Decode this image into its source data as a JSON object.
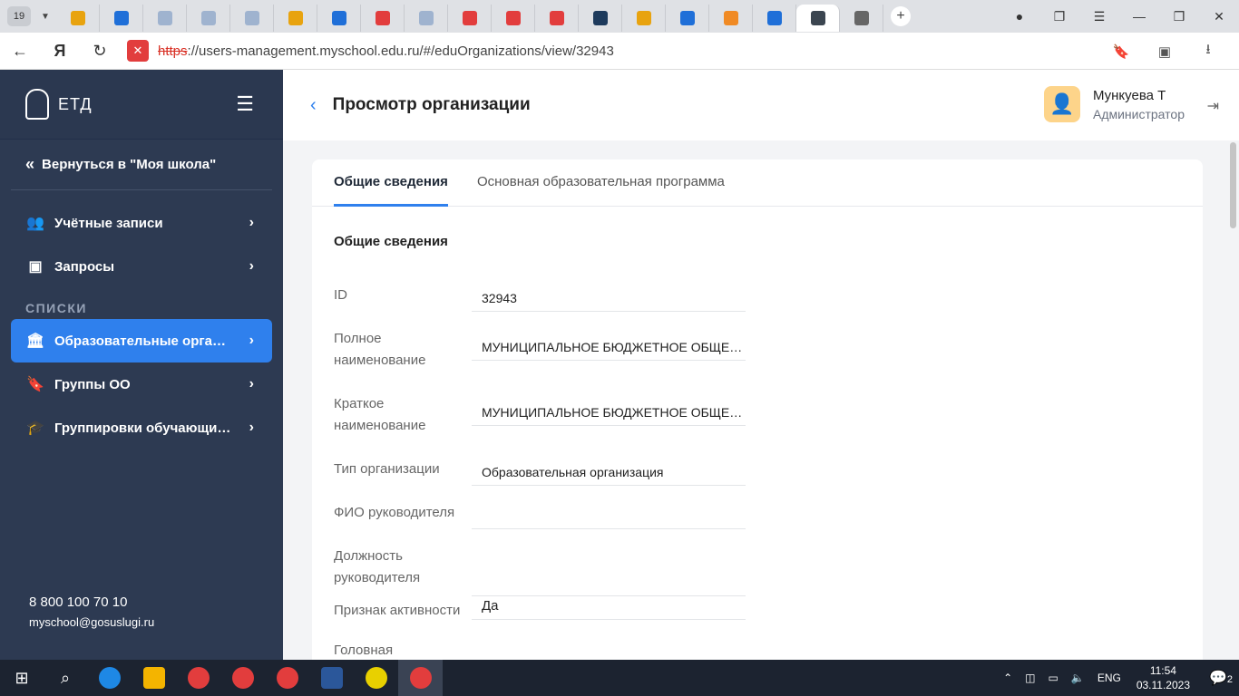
{
  "browser": {
    "tab_count": "19",
    "tab_favicons": [
      "#e8a30f",
      "#1f6fd8",
      "#9fb3cf",
      "#9fb3cf",
      "#9fb3cf",
      "#e8a30f",
      "#1f6fd8",
      "#e23d3d",
      "#9fb3cf",
      "#e23d3d",
      "#e23d3d",
      "#e23d3d",
      "#1d3a5c",
      "#e8a30f",
      "#1f6fd8",
      "#f08a24",
      "#1f6fd8",
      "#3b4550",
      "#666666"
    ],
    "url_scheme": "https",
    "url_rest": "://users-management.myschool.edu.ru/#/eduOrganizations/view/32943"
  },
  "sidebar": {
    "logo_text": "ЕТД",
    "back_link": "Вернуться в \"Моя школа\"",
    "items": [
      {
        "label": "Учётные записи",
        "icon": "users-icon"
      },
      {
        "label": "Запросы",
        "icon": "inbox-icon"
      }
    ],
    "section_title": "СПИСКИ",
    "list_items": [
      {
        "label": "Образовательные организации",
        "icon": "institution-icon",
        "active": true
      },
      {
        "label": "Группы ОО",
        "icon": "bookmark-icon",
        "active": false
      },
      {
        "label": "Группировки обучающихся",
        "icon": "graduation-cap-icon",
        "active": false
      }
    ],
    "phone": "8 800 100 70 10",
    "email": "myschool@gosuslugi.ru"
  },
  "header": {
    "title": "Просмотр организации",
    "user_name": "Мункуева Т",
    "user_role": "Администратор"
  },
  "tabs": [
    "Общие сведения",
    "Основная образовательная программа"
  ],
  "section_title": "Общие сведения",
  "fields": [
    {
      "label": "ID",
      "value": "32943"
    },
    {
      "label": "Полное наименование",
      "value": "МУНИЦИПАЛЬНОЕ БЮДЖЕТНОЕ ОБЩЕОБРАЗОВАТЕЛЬНОЕ УЧРЕЖДЕНИЕ"
    },
    {
      "label": "Краткое наименование",
      "value": "МУНИЦИПАЛЬНОЕ БЮДЖЕТНОЕ ОБЩЕОБРАЗОВАТЕЛЬНОЕ УЧРЕЖДЕНИЕ"
    },
    {
      "label": "Тип организации",
      "value": "Образовательная организация"
    },
    {
      "label": "ФИО руководителя",
      "value": ""
    },
    {
      "label": "Должность руководителя",
      "value": ""
    },
    {
      "label": "Признак активности",
      "value": "Да"
    },
    {
      "label": "Головная",
      "value": ""
    }
  ],
  "taskbar": {
    "apps": [
      "#1e88e5",
      "#f4b400",
      "#e23d3d",
      "#e23d3d",
      "#e23d3d",
      "#2b579a",
      "#e8d000",
      "#e23d3d"
    ],
    "lang": "ENG",
    "time": "11:54",
    "date": "03.11.2023",
    "notifications": "2"
  }
}
